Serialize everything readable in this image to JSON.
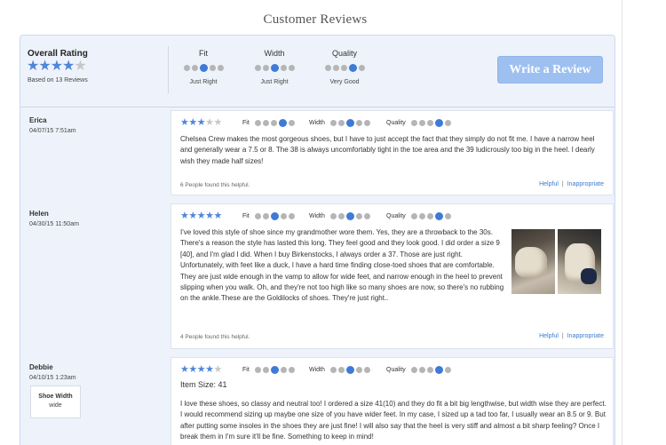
{
  "page": {
    "title": "Customer Reviews"
  },
  "summary": {
    "overall_label": "Overall Rating",
    "overall_stars": 4,
    "based_on": "Based on 13 Reviews",
    "metrics": [
      {
        "label": "Fit",
        "value": "Just Right",
        "selected": 3
      },
      {
        "label": "Width",
        "value": "Just Right",
        "selected": 3
      },
      {
        "label": "Quality",
        "value": "Very Good",
        "selected": 4
      }
    ],
    "write_review_label": "Write a Review"
  },
  "labels": {
    "fit": "Fit",
    "width": "Width",
    "quality": "Quality",
    "helpful": "Helpful",
    "separator": "|",
    "inappropriate": "Inappropriate",
    "shoe_width": "Shoe Width"
  },
  "colors": {
    "accent": "#3e7ad8",
    "button": "#9ec0f0",
    "panel": "#eef3fb",
    "link": "#3b7bd3"
  },
  "reviews": [
    {
      "name": "Erica",
      "date": "04/07/15  7:51am",
      "stars": 3,
      "fit": 4,
      "width": 3,
      "quality": 4,
      "text": "Chelsea Crew makes the most gorgeous shoes, but I have to just accept the fact that they simply do not fit me. I have a narrow heel and generally wear a 7.5 or 8. The 38 is always uncomfortably tight in the toe area and the 39 ludicrously too big in the heel. I dearly wish they made half sizes!",
      "helpful_count": "6 People found this helpful."
    },
    {
      "name": "Helen",
      "date": "04/30/15  11:50am",
      "stars": 5,
      "fit": 3,
      "width": 3,
      "quality": 4,
      "text": "I've loved this style of shoe since my grandmother wore them. Yes, they are a throwback to the 30s. There's a reason the style has lasted this long. They feel good and they look good. I did order a size 9 [40], and I'm glad I did. When I buy Birkenstocks, I always order a 37. Those are just right. Unfortunately, with feet like a duck, I have a hard time finding close-toed shoes that are comfortable. They are just wide enough in the vamp to allow for wide feet, and narrow enough in the heel to prevent slipping when you walk. Oh, and they're not too high like so many shoes are now, so there's no rubbing on the ankle.These are the Goldilocks of shoes. They're just right..",
      "helpful_count": "4 People found this helpful."
    },
    {
      "name": "Debbie",
      "date": "04/10/15  1:23am",
      "stars": 4,
      "fit": 3,
      "width": 3,
      "quality": 4,
      "item_size": "Item Size: 41",
      "shoe_width_value": "wide",
      "text": "I love these shoes, so classy and neutral too! I ordered a size 41(10) and they do fit a bit big lengthwise, but width wise they are perfect. I would recommend sizing up maybe one size of you have wider feet. In my case, I sized up a tad too far, I usually wear an 8.5 or 9. But after putting some insoles in the shoes they are just fine! I will also say that the heel is very stiff and almost a bit sharp feeling? Once I break them in I'm sure it'll be fine. Something to keep in mind!"
    }
  ]
}
